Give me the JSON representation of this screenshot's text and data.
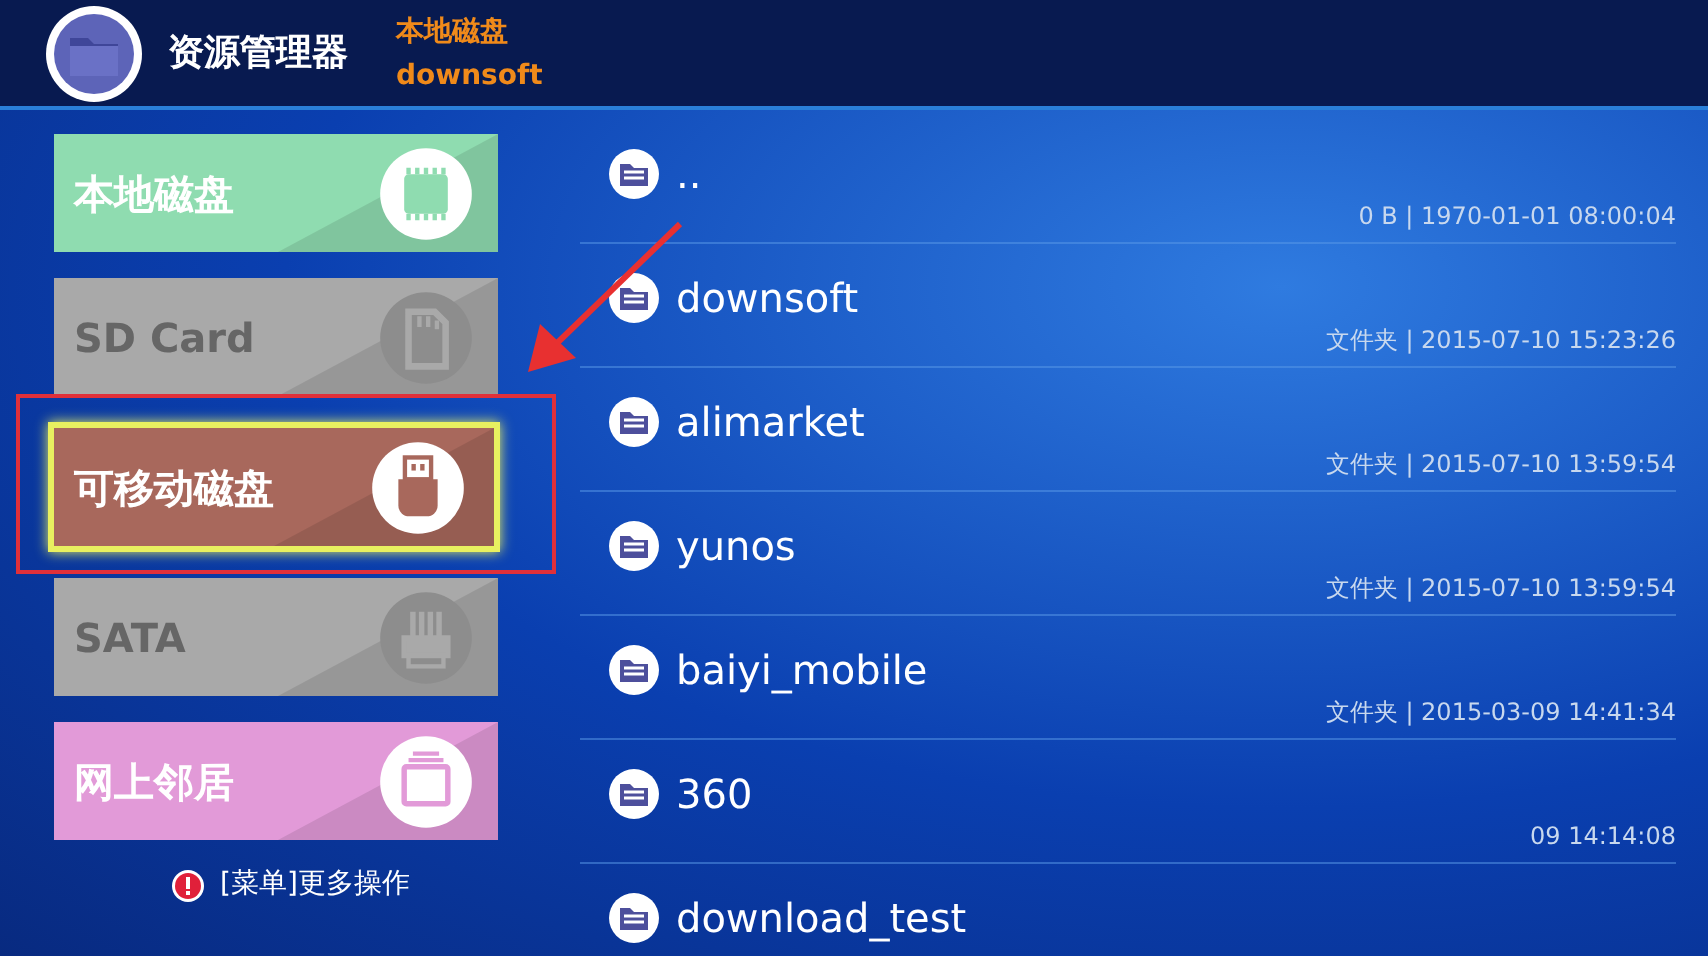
{
  "app": {
    "title": "资源管理器"
  },
  "breadcrumb": {
    "drive": "本地磁盘",
    "folder": "downsoft"
  },
  "drives": [
    {
      "label": "本地磁盘",
      "kind": "memory",
      "color": "#8fdcb0",
      "selected": false,
      "disabled": false
    },
    {
      "label": "SD Card",
      "kind": "sdcard",
      "color": "#a9a9a9",
      "selected": false,
      "disabled": true
    },
    {
      "label": "可移动磁盘",
      "kind": "usb",
      "color": "#a8685c",
      "selected": true,
      "disabled": false
    },
    {
      "label": "SATA",
      "kind": "sata",
      "color": "#a9a9a9",
      "selected": false,
      "disabled": true
    },
    {
      "label": "网上邻居",
      "kind": "network",
      "color": "#e29ad8",
      "selected": false,
      "disabled": false
    }
  ],
  "hint": "[菜单]更多操作",
  "files": [
    {
      "name": "..",
      "meta": "0 B | 1970-01-01 08:00:04"
    },
    {
      "name": "downsoft",
      "meta": "文件夹 | 2015-07-10 15:23:26"
    },
    {
      "name": "alimarket",
      "meta": "文件夹 | 2015-07-10 13:59:54"
    },
    {
      "name": "yunos",
      "meta": "文件夹 | 2015-07-10 13:59:54"
    },
    {
      "name": "baiyi_mobile",
      "meta": "文件夹 | 2015-03-09 14:41:34"
    },
    {
      "name": "360",
      "meta": "09 14:14:08"
    },
    {
      "name": "download_test"
    }
  ]
}
